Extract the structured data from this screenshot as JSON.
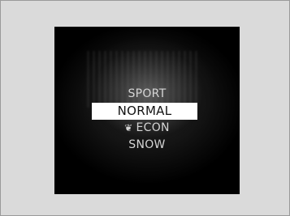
{
  "mode_menu": {
    "items": [
      {
        "label": "SPORT",
        "selected": false
      },
      {
        "label": "NORMAL",
        "selected": true
      },
      {
        "label": "ECON",
        "icon": "eco-leaf-icon",
        "selected": false
      },
      {
        "label": "SNOW",
        "selected": false
      }
    ]
  },
  "colors": {
    "screen_background": "#000000",
    "highlight": "#ffffff",
    "text": "#d5d5d5"
  }
}
